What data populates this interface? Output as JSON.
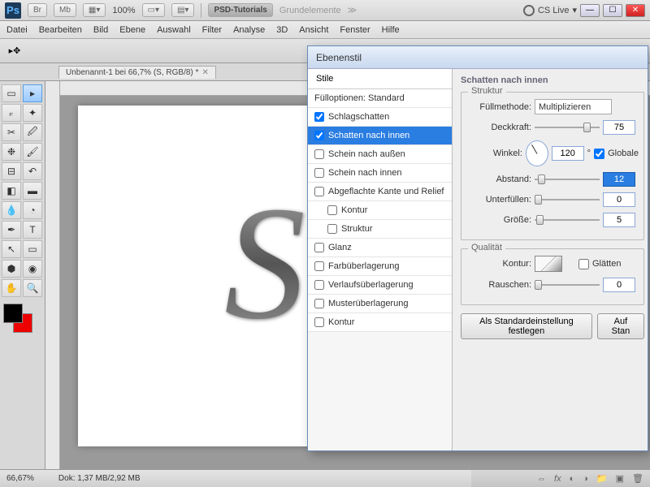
{
  "app": {
    "logo": "Ps",
    "zoom": "100%",
    "tab1": "PSD-Tutorials",
    "tab2": "Grundelemente",
    "cslive": "CS Live"
  },
  "menu": {
    "datei": "Datei",
    "bearbeiten": "Bearbeiten",
    "bild": "Bild",
    "ebene": "Ebene",
    "auswahl": "Auswahl",
    "filter": "Filter",
    "analyse": "Analyse",
    "dreid": "3D",
    "ansicht": "Ansicht",
    "fenster": "Fenster",
    "hilfe": "Hilfe"
  },
  "doc": {
    "tab": "Unbenannt-1 bei 66,7% (S, RGB/8) *",
    "letter": "S"
  },
  "status": {
    "zoom": "66,67%",
    "dok": "Dok: 1,37 MB/2,92 MB"
  },
  "dialog": {
    "title": "Ebenenstil",
    "stile": "Stile",
    "fuell": "Fülloptionen: Standard",
    "items": {
      "schlag": "Schlagschatten",
      "innen": "Schatten nach innen",
      "aussen": "Schein nach außen",
      "scheininnen": "Schein nach innen",
      "relief": "Abgeflachte Kante und Relief",
      "kontur": "Kontur",
      "struktur": "Struktur",
      "glanz": "Glanz",
      "farb": "Farbüberlagerung",
      "verlauf": "Verlaufsüberlagerung",
      "muster": "Musterüberlagerung",
      "kontur2": "Kontur"
    },
    "panel_title": "Schatten nach innen",
    "struktur_label": "Struktur",
    "fuellmethode": "Füllmethode:",
    "fuellmethode_val": "Multiplizieren",
    "deckkraft": "Deckkraft:",
    "deckkraft_val": "75",
    "winkel": "Winkel:",
    "winkel_val": "120",
    "winkel_deg": "°",
    "globale": "Globale",
    "abstand": "Abstand:",
    "abstand_val": "12",
    "unterfuellen": "Unterfüllen:",
    "unterfuellen_val": "0",
    "groesse": "Größe:",
    "groesse_val": "5",
    "qualitaet": "Qualität",
    "kontur_lbl": "Kontur:",
    "glaetten": "Glätten",
    "rauschen": "Rauschen:",
    "rauschen_val": "0",
    "btn_standard": "Als Standardeinstellung festlegen",
    "btn_reset": "Auf Stan"
  },
  "icons": {
    "br": "Br",
    "mb": "Mb"
  }
}
